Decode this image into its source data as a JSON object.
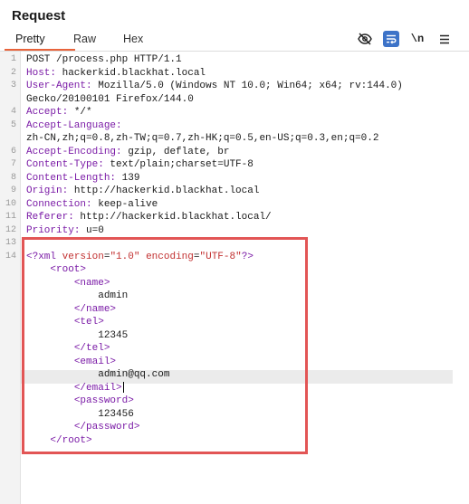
{
  "panel": {
    "title": "Request"
  },
  "tabs": [
    {
      "label": "Pretty",
      "active": true
    },
    {
      "label": "Raw",
      "active": false
    },
    {
      "label": "Hex",
      "active": false
    }
  ],
  "toolbar": {
    "hide_icon": "eye-slash-icon",
    "wrap_icon": "text-wrap-icon",
    "newline_label": "\\n",
    "menu_icon": "hamburger-menu-icon",
    "accent_color": "#3d73c8"
  },
  "request": {
    "request_line": "POST /process.php HTTP/1.1",
    "headers": [
      {
        "name": "Host",
        "value": "hackerkid.blackhat.local"
      },
      {
        "name": "User-Agent",
        "value": "Mozilla/5.0 (Windows NT 10.0; Win64; x64; rv:144.0)"
      },
      {
        "name": "",
        "value": "Gecko/20100101 Firefox/144.0"
      },
      {
        "name": "Accept",
        "value": "*/*"
      },
      {
        "name": "Accept-Language",
        "value": ""
      },
      {
        "name": "",
        "value": "zh-CN,zh;q=0.8,zh-TW;q=0.7,zh-HK;q=0.5,en-US;q=0.3,en;q=0.2"
      },
      {
        "name": "Accept-Encoding",
        "value": "gzip, deflate, br"
      },
      {
        "name": "Content-Type",
        "value": "text/plain;charset=UTF-8"
      },
      {
        "name": "Content-Length",
        "value": "139"
      },
      {
        "name": "Origin",
        "value": "http://hackerkid.blackhat.local"
      },
      {
        "name": "Connection",
        "value": "keep-alive"
      },
      {
        "name": "Referer",
        "value": "http://hackerkid.blackhat.local/"
      },
      {
        "name": "Priority",
        "value": "u=0"
      }
    ],
    "line_numbers": [
      "1",
      "2",
      "3",
      "",
      "4",
      "5",
      "",
      "6",
      "7",
      "8",
      "9",
      "10",
      "11",
      "12",
      "13",
      "14"
    ],
    "xml_decl": {
      "open": "<?xml",
      "version_attr": "version",
      "version_value": "\"1.0\"",
      "encoding_attr": "encoding",
      "encoding_value": "\"UTF-8\"",
      "close": "?>"
    },
    "body": [
      {
        "indent": 2,
        "kind": "tag",
        "text": "<root>"
      },
      {
        "indent": 4,
        "kind": "tag",
        "text": "<name>"
      },
      {
        "indent": 6,
        "kind": "text",
        "text": "admin"
      },
      {
        "indent": 4,
        "kind": "tag",
        "text": "</name>"
      },
      {
        "indent": 4,
        "kind": "tag",
        "text": "<tel>"
      },
      {
        "indent": 6,
        "kind": "text",
        "text": "12345"
      },
      {
        "indent": 4,
        "kind": "tag",
        "text": "</tel>"
      },
      {
        "indent": 4,
        "kind": "tag",
        "text": "<email>"
      },
      {
        "indent": 6,
        "kind": "text",
        "text": "admin@qq.com"
      },
      {
        "indent": 4,
        "kind": "tag",
        "text": "</email>",
        "cursor": true
      },
      {
        "indent": 4,
        "kind": "tag",
        "text": "<password>"
      },
      {
        "indent": 6,
        "kind": "text",
        "text": "123456"
      },
      {
        "indent": 4,
        "kind": "tag",
        "text": "</password>"
      },
      {
        "indent": 2,
        "kind": "tag",
        "text": "</root>"
      }
    ]
  },
  "highlight_color": "#e25555"
}
